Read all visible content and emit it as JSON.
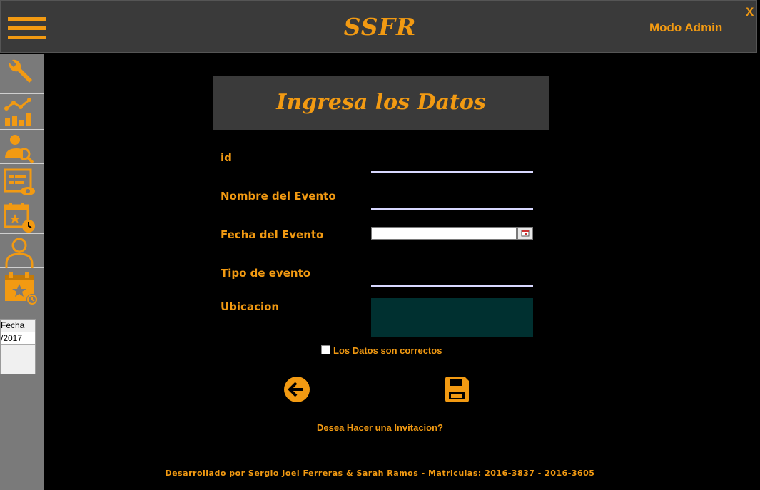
{
  "app": {
    "title": "SSFR",
    "mode": "Modo Admin",
    "close": "X"
  },
  "colors": {
    "accent": "#f29a12",
    "bar": "#3a3a3a",
    "sidebar": "#7a7a7a",
    "textarea": "#003030"
  },
  "sidebar": {
    "icons": [
      "wrench-icon",
      "stats-chart-icon",
      "user-search-icon",
      "event-list-view-icon",
      "calendar-clock-icon",
      "user-icon",
      "calendar-star-icon"
    ],
    "mini_table": {
      "header": "Fecha",
      "row": "/2017"
    }
  },
  "form": {
    "title": "Ingresa los Datos",
    "fields": {
      "id": {
        "label": "id",
        "value": ""
      },
      "nombre": {
        "label": "Nombre del Evento",
        "value": ""
      },
      "fecha": {
        "label": "Fecha del Evento",
        "value": ""
      },
      "tipo": {
        "label": "Tipo de evento",
        "value": ""
      },
      "ubicacion": {
        "label": "Ubicacion",
        "value": ""
      }
    },
    "checkbox": {
      "label": "Los Datos son correctos",
      "checked": false
    },
    "back_icon": "arrow-left-icon",
    "save_icon": "floppy-disk-icon",
    "invite_link": "Desea Hacer una Invitacion?"
  },
  "footer": {
    "credits": "Desarrollado por Sergio Joel Ferreras & Sarah Ramos - Matriculas: 2016-3837 - 2016-3605"
  }
}
